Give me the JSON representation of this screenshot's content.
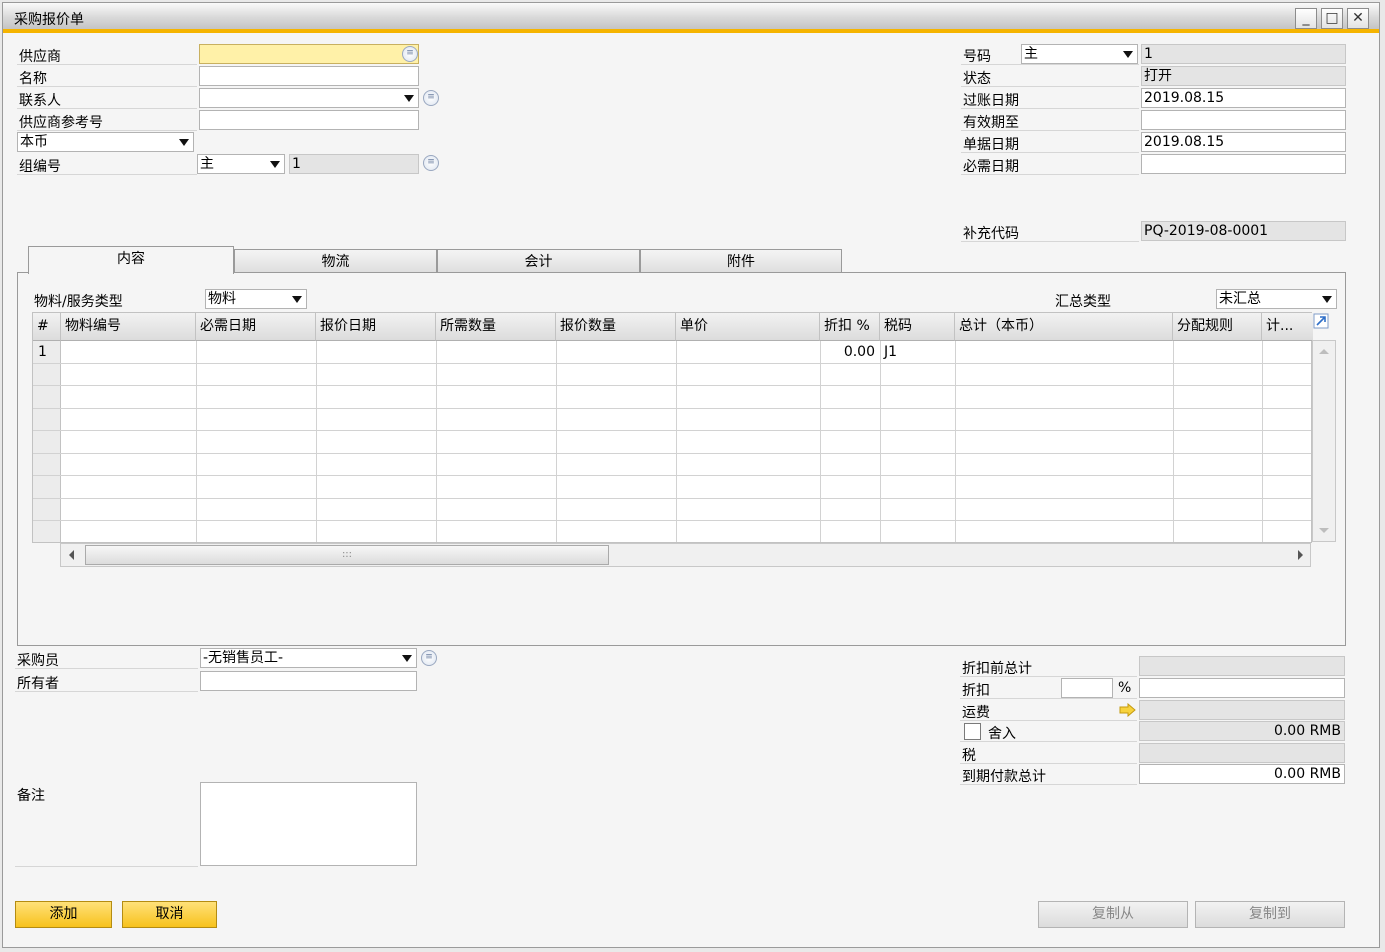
{
  "window": {
    "title": "采购报价单",
    "min": "_",
    "max": "□",
    "close": "✕"
  },
  "header_left": {
    "vendor_label": "供应商",
    "vendor_value": "",
    "name_label": "名称",
    "name_value": "",
    "contact_label": "联系人",
    "contact_value": "",
    "vendor_ref_label": "供应商参考号",
    "vendor_ref_value": "",
    "currency_value": "本币",
    "group_label": "组编号",
    "group_series": "主",
    "group_value": "1"
  },
  "header_right": {
    "number_label": "号码",
    "number_series": "主",
    "number_value": "1",
    "status_label": "状态",
    "status_value": "打开",
    "posting_date_label": "过账日期",
    "posting_date_value": "2019.08.15",
    "valid_until_label": "有效期至",
    "valid_until_value": "",
    "doc_date_label": "单据日期",
    "doc_date_value": "2019.08.15",
    "required_date_label": "必需日期",
    "required_date_value": "",
    "supp_code_label": "补充代码",
    "supp_code_value": "PQ-2019-08-0001"
  },
  "tabs": [
    "内容",
    "物流",
    "会计",
    "附件"
  ],
  "contents": {
    "item_type_label": "物料/服务类型",
    "item_type_value": "物料",
    "summary_type_label": "汇总类型",
    "summary_type_value": "未汇总",
    "columns": [
      "#",
      "物料编号",
      "必需日期",
      "报价日期",
      "所需数量",
      "报价数量",
      "单价",
      "折扣 %",
      "税码",
      "总计（本币）",
      "分配规则",
      "计..."
    ],
    "row1": {
      "num": "1",
      "discount": "0.00",
      "tax": "J1"
    }
  },
  "footer_left": {
    "buyer_label": "采购员",
    "buyer_value": "-无销售员工-",
    "owner_label": "所有者",
    "owner_value": "",
    "remarks_label": "备注"
  },
  "footer_right": {
    "total_before_label": "折扣前总计",
    "total_before_value": "",
    "discount_label": "折扣",
    "discount_pct": "",
    "pct_sign": "%",
    "discount_value": "",
    "freight_label": "运费",
    "freight_value": "",
    "rounding_label": "舍入",
    "rounding_value": "0.00 RMB",
    "tax_label": "税",
    "tax_value": "",
    "total_due_label": "到期付款总计",
    "total_due_value": "0.00 RMB"
  },
  "buttons": {
    "add": "添加",
    "cancel": "取消",
    "copy_from": "复制从",
    "copy_to": "复制到"
  }
}
